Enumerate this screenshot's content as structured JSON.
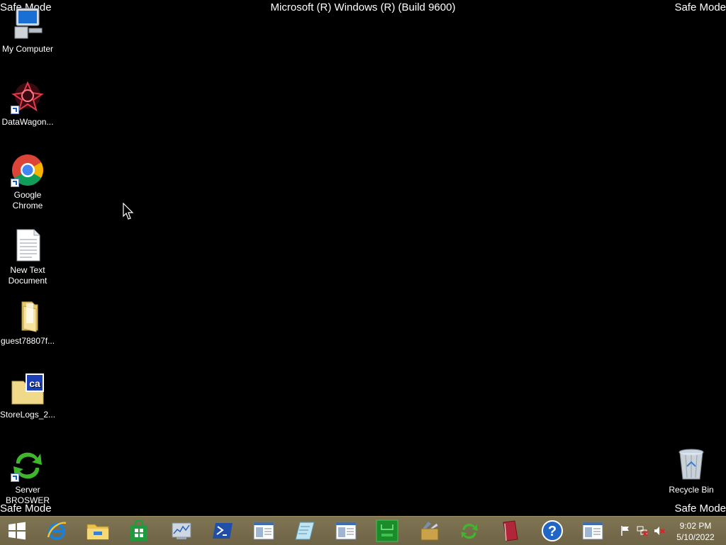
{
  "watermark": {
    "top_left": "Safe Mode",
    "top_right": "Safe Mode",
    "bottom_left": "Safe Mode",
    "bottom_right": "Safe Mode",
    "title": "Microsoft (R) Windows (R) (Build 9600)"
  },
  "desktop_icons": [
    {
      "label": "My Computer",
      "icon": "computer-icon"
    },
    {
      "label": "DataWagon...",
      "icon": "datawagon-icon"
    },
    {
      "label": "Google Chrome",
      "icon": "chrome-icon"
    },
    {
      "label": "New Text Document",
      "icon": "text-document-icon"
    },
    {
      "label": "guest78807f...",
      "icon": "folder-icon"
    },
    {
      "label": "StoreLogs_2...",
      "icon": "ca-folder-icon"
    },
    {
      "label": "Server BROSWER",
      "icon": "refresh-arrows-icon"
    },
    {
      "label": "Recycle Bin",
      "icon": "recycle-bin-icon"
    }
  ],
  "taskbar": {
    "items": [
      "start-icon",
      "internet-explorer-icon",
      "file-explorer-icon",
      "store-icon",
      "performance-monitor-icon",
      "powershell-icon",
      "window-icon",
      "notepad-icon",
      "window-icon",
      "terminal-icon",
      "tools-icon",
      "sync-icon",
      "book-icon",
      "help-icon",
      "window-icon"
    ],
    "tray": [
      "flag-icon",
      "network-icon",
      "volume-muted-icon"
    ],
    "clock": {
      "time": "9:02 PM",
      "date": "5/10/2022"
    }
  },
  "colors": {
    "desktop_bg": "#000000",
    "taskbar_bg": "#7a6f4c",
    "ie_blue": "#1d7fd6",
    "store_green": "#1f9a3d"
  }
}
